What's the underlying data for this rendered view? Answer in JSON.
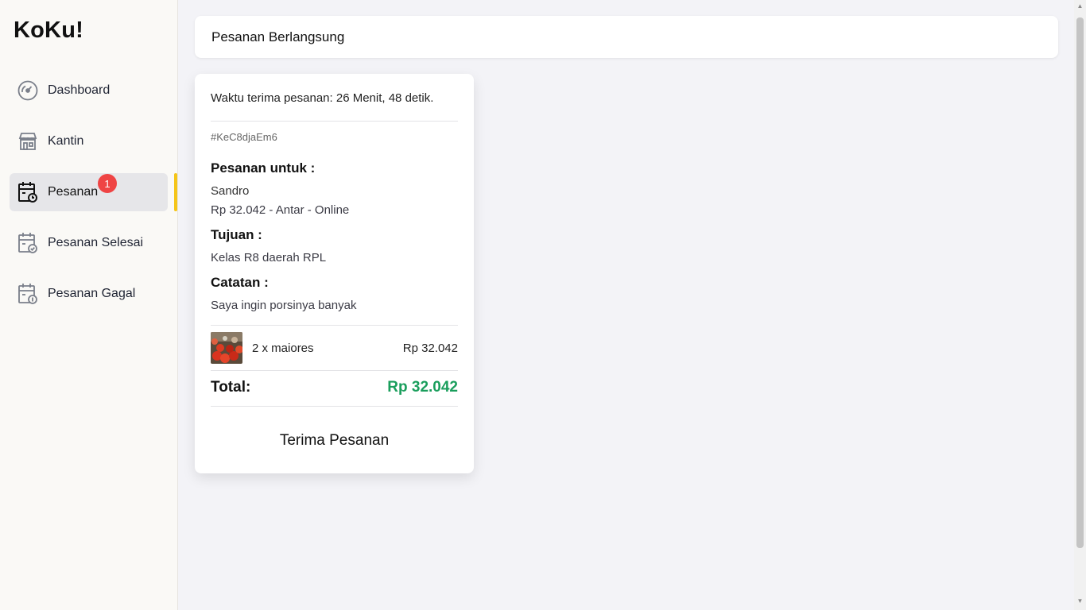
{
  "sidebar": {
    "brand": "KoKu!",
    "items": [
      {
        "label": "Dashboard",
        "icon": "dashboard-gauge-icon"
      },
      {
        "label": "Kantin",
        "icon": "store-icon"
      },
      {
        "label": "Pesanan",
        "icon": "calendar-clock-icon",
        "badge": "1",
        "active": true
      },
      {
        "label": "Pesanan Selesai",
        "icon": "calendar-check-icon"
      },
      {
        "label": "Pesanan Gagal",
        "icon": "calendar-alert-icon"
      }
    ]
  },
  "header": {
    "title": "Pesanan Berlangsung"
  },
  "order": {
    "timer_text": "Waktu terima pesanan: 26 Menit, 48 detik.",
    "id": "#KeC8djaEm6",
    "for_label": "Pesanan untuk :",
    "customer_name": "Sandro",
    "summary": "Rp 32.042 - Antar - Online",
    "destination_label": "Tujuan :",
    "destination": "Kelas R8 daerah RPL",
    "note_label": "Catatan :",
    "note": "Saya ingin porsinya banyak",
    "items": [
      {
        "qty_name": "2 x maiores",
        "price": "Rp 32.042"
      }
    ],
    "total_label": "Total:",
    "total_value": "Rp 32.042",
    "accept_button": "Terima Pesanan"
  },
  "colors": {
    "active_bar": "#f5c518",
    "badge": "#ef4444",
    "total": "#1a9e5c"
  }
}
